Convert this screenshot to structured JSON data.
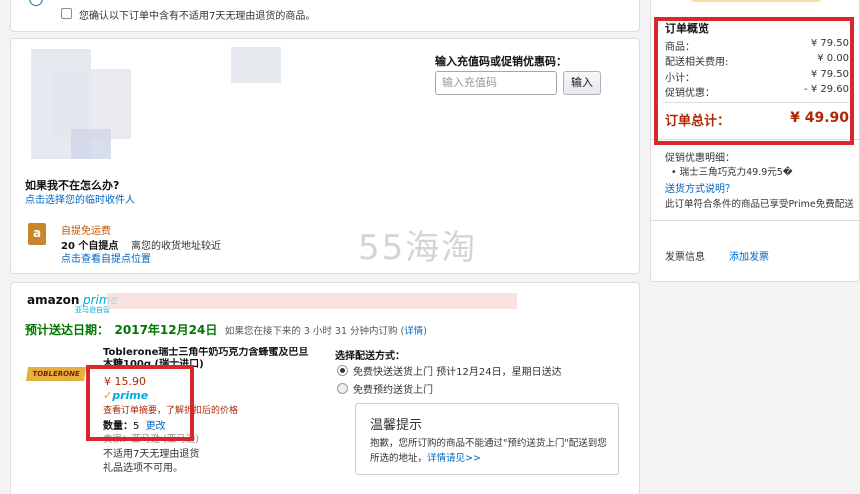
{
  "top": {
    "confirm_text": "您确认以下订单中含有不适用7天无理由退货的商品。"
  },
  "address": {
    "promo_title": "输入充值码或促销优惠码：",
    "promo_placeholder": "输入充值码",
    "apply_label": "输入",
    "not_home_title": "如果我不在怎么办?",
    "not_home_link": "点击选择您的临时收件人",
    "pickup_title": "自提免运费",
    "pickup_count": "20 个自提点",
    "pickup_desc": "离您的收货地址较近",
    "pickup_link": "点击查看自提点位置"
  },
  "shipment": {
    "amazon": "amazon",
    "prime": "prime",
    "prime_sub": "亚马逊自营",
    "delivery_label": "预计送达日期：",
    "delivery_date": "2017年12月24日",
    "delivery_note": "如果您在接下来的 3 小时 31 分钟内订购 (",
    "details_link": "详情",
    "paren_close": ")",
    "product_name": "Toblerone瑞士三角牛奶巧克力含蜂蜜及巴旦木糖100g (瑞士进口)",
    "product_image_text": "TOBLERONE",
    "price": "¥ 15.90",
    "prime_badge": "prime",
    "price_note": "查看订单摘要，了解折扣后的价格",
    "qty_label": "数量：",
    "qty_value": "5",
    "qty_change": "更改",
    "seller": "卖家：亚马逊 (亚马逊)",
    "no_return": "不适用7天无理由退货",
    "no_gift": "礼品选项不可用。",
    "ship_title": "选择配送方式：",
    "ship_opt1": "免费快送送货上门 预计12月24日，星期日送达",
    "ship_opt2": "免费预约送货上门",
    "tip_title": "温馨提示",
    "tip_body": "抱歉，您所订购的商品不能通过\"预约送货上门\"配送到您所选的地址，",
    "tip_link": "详情请见>>"
  },
  "summary": {
    "title": "订单概览",
    "rows": [
      {
        "label": "商品：",
        "value": "¥ 79.50"
      },
      {
        "label": "配送相关费用:",
        "value": "¥ 0.00"
      },
      {
        "label": "小计：",
        "value": "¥ 79.50"
      },
      {
        "label": "促销优惠：",
        "value": "- ¥ 29.60"
      }
    ],
    "total_label": "订单总计：",
    "total_value": "¥ 49.90",
    "promo_detail_title": "促销优惠明细：",
    "promo_detail_item": "瑞士三角巧克力49.9元5�",
    "ship_method_link": "送货方式说明？",
    "prime_free": "此订单符合条件的商品已享受Prime免费配送",
    "invoice_label": "发票信息",
    "invoice_link": "添加发票"
  },
  "watermark": "55海淘",
  "colors": {
    "accent_red": "#b12704",
    "delivery_green": "#007600",
    "frame_red": "#d9272e",
    "link_blue": "#0066c0"
  }
}
